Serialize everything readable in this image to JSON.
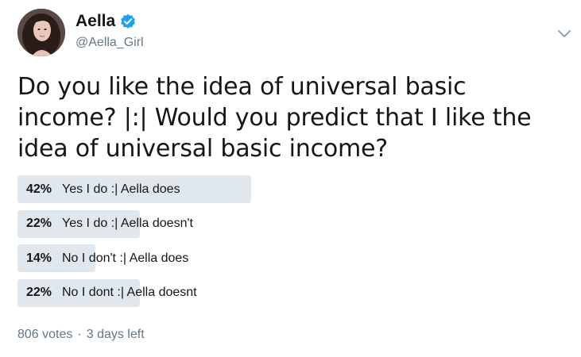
{
  "author": {
    "display_name": "Aella",
    "handle": "@Aella_Girl",
    "verified": true,
    "verified_icon": "verified-badge-icon",
    "avatar_icon": "profile-photo"
  },
  "menu_icon": "chevron-down-icon",
  "tweet": {
    "text": "Do you like the idea of universal basic income? |:| Would you predict that I like the idea of universal basic income?"
  },
  "poll": {
    "options": [
      {
        "percent_label": "42%",
        "percent": 42,
        "label": "Yes I do :| Aella does"
      },
      {
        "percent_label": "22%",
        "percent": 22,
        "label": "Yes I do :| Aella doesn't"
      },
      {
        "percent_label": "14%",
        "percent": 14,
        "label": "No I don't :| Aella does"
      },
      {
        "percent_label": "22%",
        "percent": 22,
        "label": "No I dont :| Aella doesnt"
      }
    ],
    "votes": "806 votes",
    "separator": "·",
    "time_left": "3 days left"
  },
  "colors": {
    "bar": "#e1e8ed",
    "verified": "#1da1f2",
    "secondary_text": "#657786",
    "primary_text": "#14171a"
  }
}
